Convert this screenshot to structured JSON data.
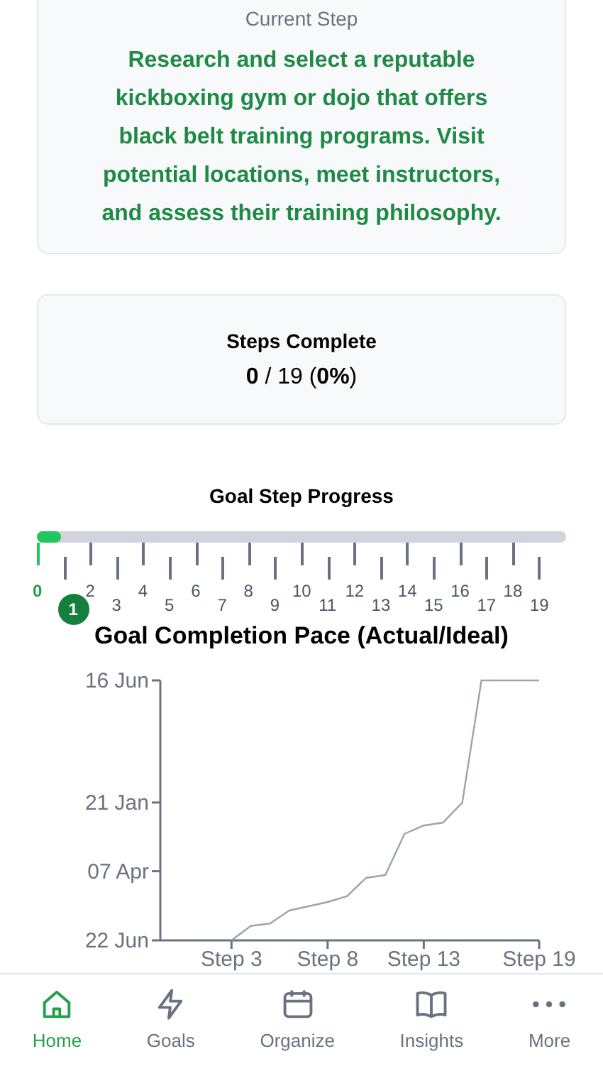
{
  "current_step": {
    "label": "Current Step",
    "text": "Research and select a reputable kickboxing gym or dojo that offers black belt training programs. Visit potential locations, meet instructors, and assess their training philosophy."
  },
  "steps_complete": {
    "title": "Steps Complete",
    "value": "**0** / 19 (**0%**)"
  },
  "step_progress": {
    "title": "Goal Step Progress",
    "level": 0.045,
    "marker": "1",
    "ticks": [
      {
        "label": "0",
        "reached": true
      },
      {
        "reached": false
      },
      {
        "label": "2",
        "reached": false
      },
      {
        "label": "3",
        "reached": false
      },
      {
        "label": "4",
        "reached": false
      },
      {
        "label": "5",
        "reached": false
      },
      {
        "label": "6",
        "reached": false
      },
      {
        "label": "7",
        "reached": false
      },
      {
        "label": "8",
        "reached": false
      },
      {
        "label": "9",
        "reached": false
      },
      {
        "label": "10",
        "reached": false
      },
      {
        "label": "11",
        "reached": false
      },
      {
        "label": "12",
        "reached": false
      },
      {
        "label": "13",
        "reached": false
      },
      {
        "label": "14",
        "reached": false
      },
      {
        "label": "15",
        "reached": false
      },
      {
        "label": "16",
        "reached": false
      },
      {
        "label": "17",
        "reached": false
      },
      {
        "label": "18",
        "reached": false
      },
      {
        "label": "19",
        "reached": false
      }
    ]
  },
  "pace_chart": {
    "title": "Goal Completion Pace (Actual/Ideal)",
    "y_axis_labels": [
      "16 Jun",
      "21 Jan",
      "07 Apr",
      "22 Jun"
    ],
    "x_axis_labels": [
      "Step 3",
      "Step 8",
      "Step 13",
      "Step 19"
    ]
  },
  "nav": [
    {
      "label": "Home",
      "selected": true
    },
    {
      "label": "Goals",
      "selected": false
    },
    {
      "label": "Organize",
      "selected": false
    },
    {
      "label": "Insights",
      "selected": false
    },
    {
      "label": "More",
      "selected": false
    }
  ]
}
